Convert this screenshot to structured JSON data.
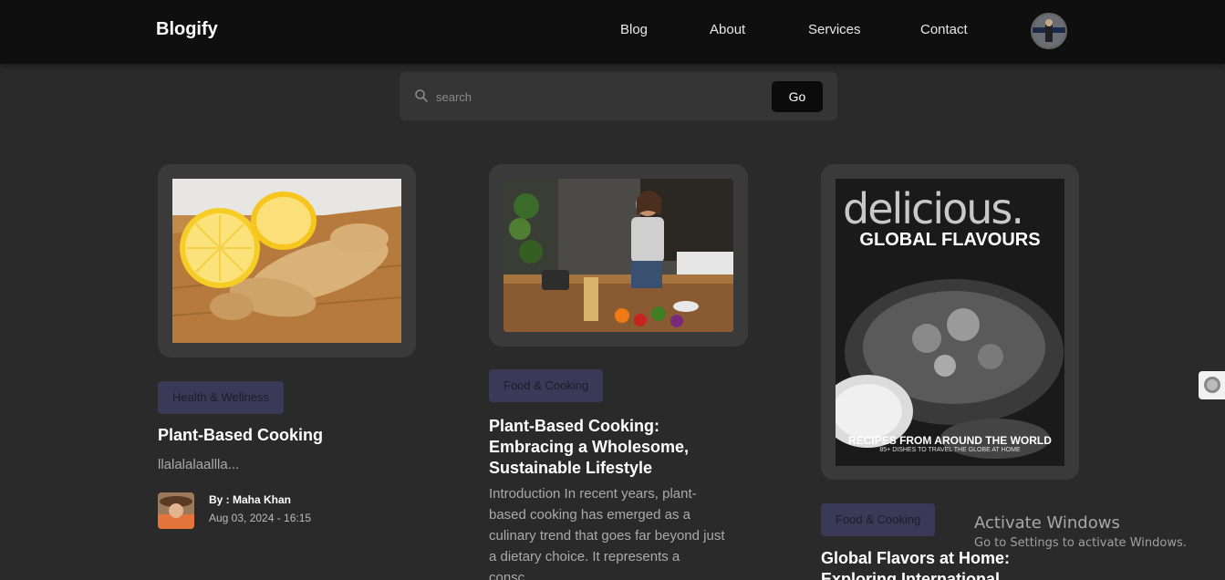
{
  "header": {
    "brand": "Blogify",
    "nav": [
      "Blog",
      "About",
      "Services",
      "Contact"
    ]
  },
  "search": {
    "placeholder": "search",
    "button_label": "Go"
  },
  "posts": [
    {
      "category": "Health & Wellness",
      "title": "Plant-Based Cooking",
      "excerpt": "llalalalaallla...",
      "author": "By : Maha Khan",
      "date": "Aug 03, 2024 - 16:15"
    },
    {
      "category": "Food & Cooking",
      "title": "Plant-Based Cooking: Embracing a Wholesome, Sustainable Lifestyle",
      "excerpt": "Introduction In recent years, plant-based cooking has emerged as a culinary trend that goes far beyond just a dietary choice. It represents a consc..."
    },
    {
      "category": "Food & Cooking",
      "title": "Global Flavors at Home: Exploring International",
      "image_text": {
        "masthead": "delicious.",
        "headline": "GLOBAL FLAVOURS",
        "footer": "RECIPES FROM AROUND THE WORLD",
        "footer_sub": "85+ DISHES TO TRAVEL THE GLOBE AT HOME"
      }
    }
  ],
  "windows_watermark": {
    "title": "Activate Windows",
    "subtitle": "Go to Settings to activate Windows."
  },
  "colors": {
    "page_bg": "#2a2a2a",
    "navbar_bg": "#0f0f0f",
    "card_frame": "#3a3a3a",
    "tag_bg": "#3a3a58"
  },
  "icons": {
    "search": "search-icon",
    "profile": "avatar"
  }
}
